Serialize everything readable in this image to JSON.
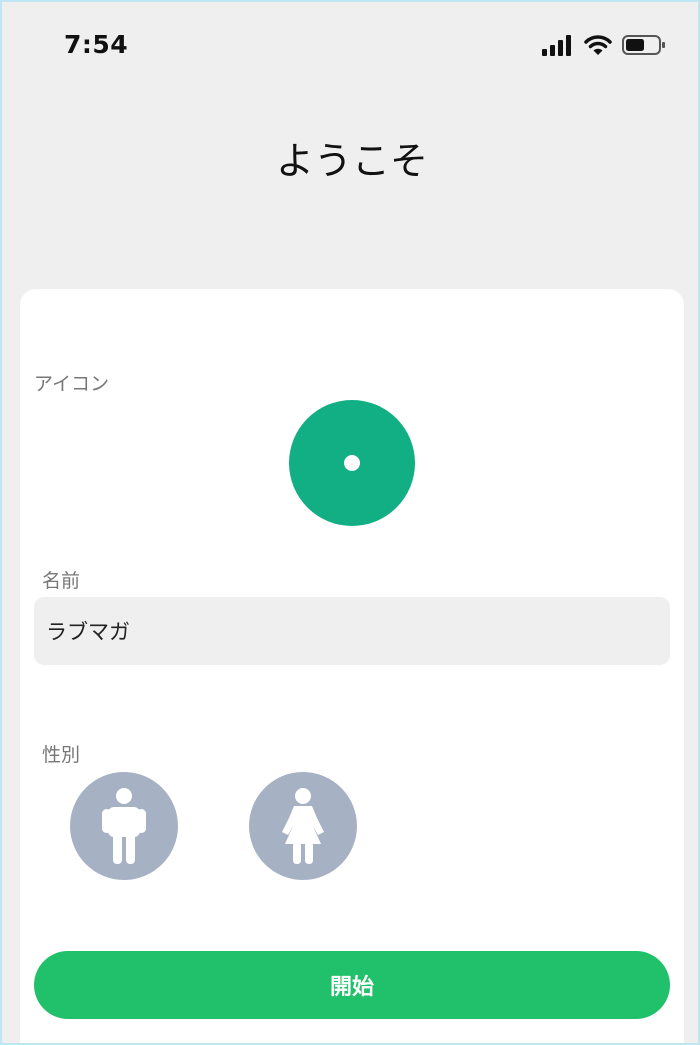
{
  "status_bar": {
    "time": "7:54",
    "icons": [
      "signal-icon",
      "wifi-icon",
      "battery-icon"
    ]
  },
  "header": {
    "title": "ようこそ"
  },
  "form": {
    "icon_label": "アイコン",
    "avatar_color": "#12ae84",
    "name_label": "名前",
    "name_value": "ラブマガ",
    "gender_label": "性別",
    "gender_options": [
      {
        "icon": "male-icon"
      },
      {
        "icon": "female-icon"
      }
    ],
    "gender_button_color": "#a6b2c4",
    "start_button_label": "開始",
    "start_button_color": "#21c06a"
  }
}
